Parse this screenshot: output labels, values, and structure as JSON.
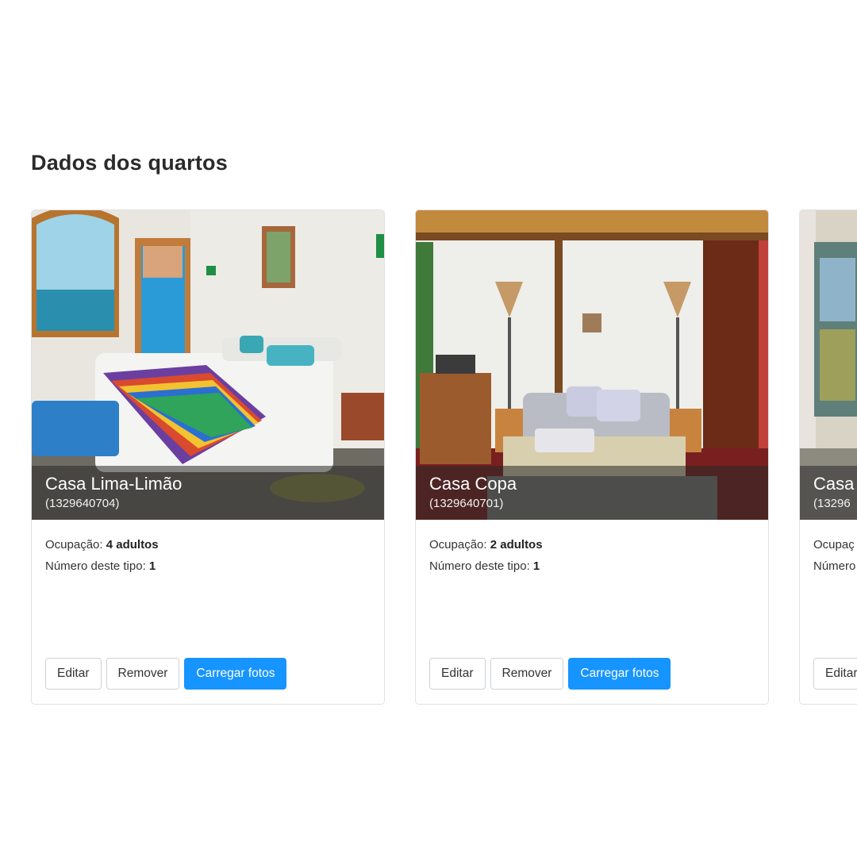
{
  "page": {
    "title": "Dados dos quartos"
  },
  "labels": {
    "occupancy": "Ocupação:",
    "count": "Número deste tipo:"
  },
  "buttons": {
    "edit": "Editar",
    "remove": "Remover",
    "upload": "Carregar fotos"
  },
  "colors": {
    "primary": "#1694ff"
  },
  "rooms": [
    {
      "name": "Casa Lima-Limão",
      "code": "(1329640704)",
      "occupancy": "4 adultos",
      "count": "1"
    },
    {
      "name": "Casa Copa",
      "code": "(1329640701)",
      "occupancy": "2 adultos",
      "count": "1"
    },
    {
      "name": "Casa",
      "code": "(13296",
      "occupancy": "",
      "count": ""
    }
  ],
  "third_card_partial": {
    "occupancy_label": "Ocupaç",
    "count_label": "Número",
    "edit_label": "Editar"
  }
}
